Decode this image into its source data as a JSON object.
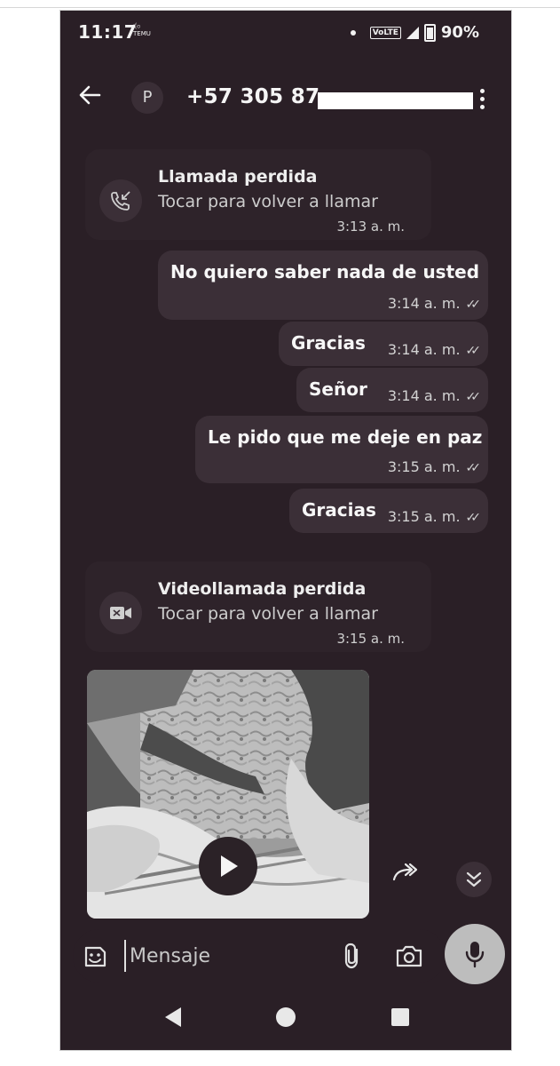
{
  "status_bar": {
    "time": "11:17",
    "notification_label": "ৰ্হ৩ TEMU",
    "network_label": "VoLTE",
    "battery": "90%"
  },
  "header": {
    "avatar_letter": "P",
    "contact_name": "+57 305 87"
  },
  "messages": [
    {
      "kind": "call",
      "title": "Llamada perdida",
      "subtitle": "Tocar para volver a llamar",
      "time": "3:13 a. m.",
      "icon": "missed-call-icon"
    },
    {
      "kind": "sent",
      "text": "No quiero saber nada de usted",
      "time": "3:14 a. m."
    },
    {
      "kind": "sent",
      "text": "Gracias",
      "time": "3:14 a. m."
    },
    {
      "kind": "sent",
      "text": "Señor",
      "time": "3:14 a. m."
    },
    {
      "kind": "sent",
      "text": "Le pido que me deje en paz",
      "time": "3:15 a. m."
    },
    {
      "kind": "sent",
      "text": "Gracias",
      "time": "3:15 a. m."
    },
    {
      "kind": "call",
      "title": "Videollamada perdida",
      "subtitle": "Tocar para volver a llamar",
      "time": "3:15 a. m.",
      "icon": "missed-video-call-icon"
    }
  ],
  "ticks_glyph": "✓✓",
  "composer": {
    "placeholder": "Mensaje"
  },
  "colors": {
    "background": "#2a1f26",
    "bubble": "#3b2f37",
    "text": "#f7f7f7"
  }
}
